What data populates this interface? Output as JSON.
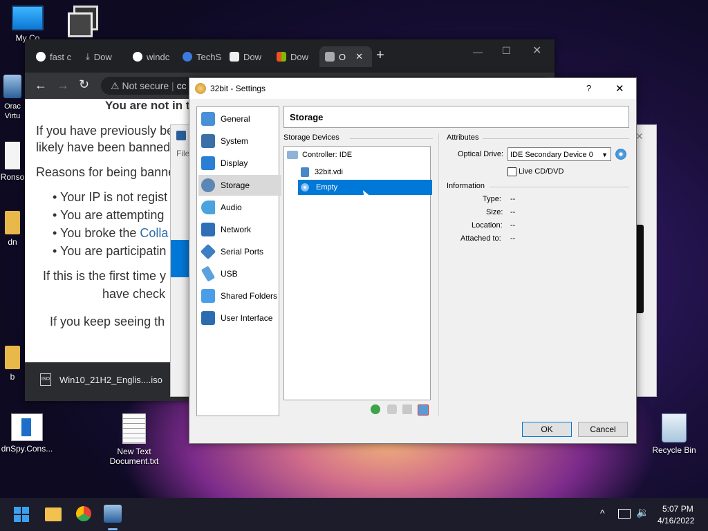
{
  "desktop": {
    "icons": [
      {
        "label": "My Co",
        "icon": "monitor-icon"
      },
      {
        "label": "Orac Virtu",
        "icon": "virtualbox-icon"
      },
      {
        "label": "Ronso",
        "icon": "file-icon"
      },
      {
        "label": "dn",
        "icon": "folder-icon"
      },
      {
        "label": "b",
        "icon": "folder-icon"
      },
      {
        "label": "dnSpy.Cons...",
        "icon": "app-icon"
      },
      {
        "label": "New Text Document.txt",
        "icon": "text-file-icon"
      },
      {
        "label": "Recycle Bin",
        "icon": "recycle-bin-icon"
      }
    ]
  },
  "browser": {
    "tabs": [
      {
        "label": "fast c",
        "icon": "google-icon"
      },
      {
        "label": "Dow",
        "icon": "download-icon"
      },
      {
        "label": "windc",
        "icon": "google-icon"
      },
      {
        "label": "TechS",
        "icon": "techspot-icon"
      },
      {
        "label": "Dow",
        "icon": "it-icon"
      },
      {
        "label": "Dow",
        "icon": "windows-icon"
      },
      {
        "label": "O",
        "icon": "site-icon"
      }
    ],
    "new_tab": "+",
    "security": "Not secure",
    "url": "cc",
    "heading": "You are not in t",
    "p1": "If you have previously be",
    "p1b": "likely have been banned.",
    "reasons": "Reasons for being banne",
    "bullets": [
      "Your IP is not regist",
      "You are attempting",
      "You broke the ",
      "You are participatin"
    ],
    "bullet_link": "Colla",
    "p2a": "If this is the first time y",
    "p2b": "have check",
    "p3": "If you keep seeing th",
    "download": "Win10_21H2_Englis....iso"
  },
  "vbox_manager": {
    "file_menu": "File"
  },
  "dialog": {
    "title": "32bit - Settings",
    "help": "?",
    "close": "✕",
    "section_title": "Storage",
    "nav": [
      {
        "label": "General",
        "icon": "general-icon",
        "color": "#4a90d9"
      },
      {
        "label": "System",
        "icon": "system-icon",
        "color": "#3c6ea8"
      },
      {
        "label": "Display",
        "icon": "display-icon",
        "color": "#2a7fd4"
      },
      {
        "label": "Storage",
        "icon": "storage-icon",
        "color": "#5a87b5"
      },
      {
        "label": "Audio",
        "icon": "audio-icon",
        "color": "#4aa3df"
      },
      {
        "label": "Network",
        "icon": "network-icon",
        "color": "#2f6fb7"
      },
      {
        "label": "Serial Ports",
        "icon": "serial-ports-icon",
        "color": "#3d7fc4"
      },
      {
        "label": "USB",
        "icon": "usb-icon",
        "color": "#5ba1e0"
      },
      {
        "label": "Shared Folders",
        "icon": "shared-folders-icon",
        "color": "#4a9ee8"
      },
      {
        "label": "User Interface",
        "icon": "user-interface-icon",
        "color": "#2b6cb0"
      }
    ],
    "selected_nav": "Storage",
    "storage_devices_label": "Storage Devices",
    "tree": {
      "controller": "Controller: IDE",
      "items": [
        "32bit.vdi",
        "Empty"
      ]
    },
    "attributes_label": "Attributes",
    "optical_drive_label": "Optical Drive:",
    "optical_drive_value": "IDE Secondary Device 0",
    "live_cd": "Live CD/DVD",
    "information_label": "Information",
    "info": [
      {
        "k": "Type:",
        "v": "--"
      },
      {
        "k": "Size:",
        "v": "--"
      },
      {
        "k": "Location:",
        "v": "--"
      },
      {
        "k": "Attached to:",
        "v": "--"
      }
    ],
    "ok": "OK",
    "cancel": "Cancel"
  },
  "taskbar": {
    "time": "5:07 PM",
    "date": "4/16/2022"
  }
}
